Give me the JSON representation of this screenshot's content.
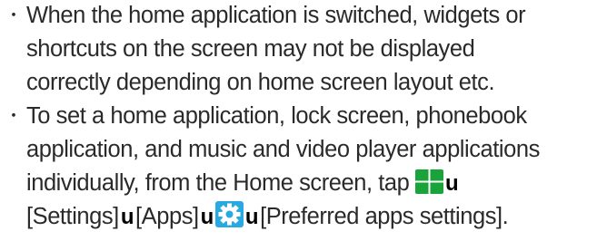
{
  "notes": [
    {
      "bullet": "・",
      "lines": [
        "When the home application is switched, widgets or",
        "shortcuts on the screen may not be displayed",
        "correctly depending on home screen layout etc."
      ]
    },
    {
      "bullet": "・",
      "lines": [
        "To set a home application, lock screen, phonebook",
        "application, and music and video player applications",
        "individually, from the Home screen, tap"
      ],
      "steps": {
        "separator": "u",
        "settings": "[Settings]",
        "apps": "[Apps]",
        "preferred": "[Preferred apps settings]."
      }
    }
  ],
  "icons": {
    "menu_grid_icon": "grid-menu-icon",
    "gear_icon": "settings-gear-icon",
    "menu_color": "#1aa33a",
    "gear_color": "#29a9e1"
  }
}
